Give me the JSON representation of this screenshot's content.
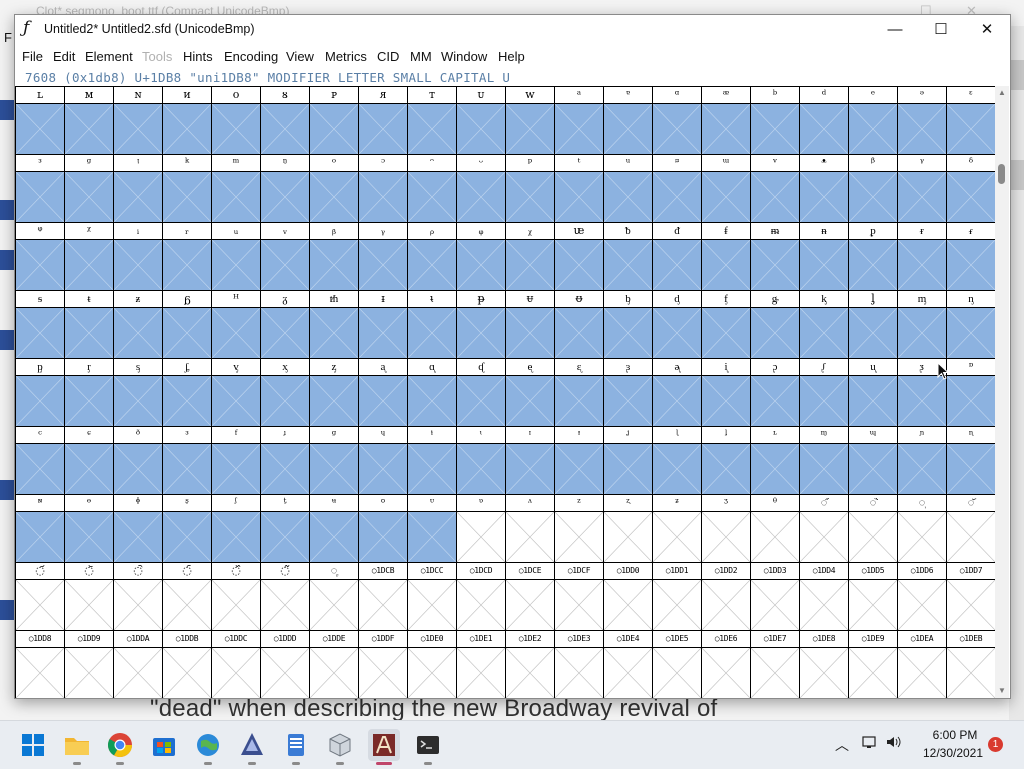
{
  "background_window": {
    "title": "Clot*  segmono_boot.ttf (Compact UnicodeBmp)",
    "menu_letter": "F",
    "caption_text": "\"dead\" when describing the new Broadway revival of"
  },
  "window": {
    "app_icon_glyph": "ƒ",
    "title": "Untitled2*  Untitled2.sfd (UnicodeBmp)",
    "minimize": "—",
    "maximize": "☐",
    "close": "✕"
  },
  "menu": [
    {
      "label": "File",
      "enabled": true
    },
    {
      "label": "Edit",
      "enabled": true
    },
    {
      "label": "Element",
      "enabled": true
    },
    {
      "label": "Tools",
      "enabled": false
    },
    {
      "label": "Hints",
      "enabled": true
    },
    {
      "label": "Encoding",
      "enabled": true
    },
    {
      "label": "View",
      "enabled": true
    },
    {
      "label": "Metrics",
      "enabled": true
    },
    {
      "label": "CID",
      "enabled": true
    },
    {
      "label": "MM",
      "enabled": true
    },
    {
      "label": "Window",
      "enabled": true
    },
    {
      "label": "Help",
      "enabled": true
    }
  ],
  "info_line": "7608 (0x1db8) U+1DB8 \"uni1DB8\" MODIFIER LETTER SMALL CAPITAL U",
  "colors": {
    "filled_cell": "#8cb2e0",
    "info_text": "#5a7fa6"
  },
  "grid": {
    "columns": 20,
    "rows": [
      {
        "labels": [
          "ʟ",
          "ᴍ",
          "ɴ",
          "ᴎ",
          "ᴏ",
          "ᴕ",
          "ᴘ",
          "ᴙ",
          "ᴛ",
          "ᴜ",
          "ᴡ",
          "ᵃ",
          "ᵄ",
          "ᵅ",
          "ᵆ",
          "ᵇ",
          "ᵈ",
          "ᵉ",
          "ᵊ",
          "ᵋ"
        ],
        "filled": 20
      },
      {
        "labels": [
          "ᵌ",
          "ᵍ",
          "ᵎ",
          "ᵏ",
          "ᵐ",
          "ᵑ",
          "ᵒ",
          "ᵓ",
          "ᵔ",
          "ᵕ",
          "ᵖ",
          "ᵗ",
          "ᵘ",
          "ᵙ",
          "ᵚ",
          "ᵛ",
          "ᵜ",
          "ᵝ",
          "ᵞ",
          "ᵟ"
        ],
        "filled": 20
      },
      {
        "labels": [
          "ᵠ",
          "ᵡ",
          "ᵢ",
          "ᵣ",
          "ᵤ",
          "ᵥ",
          "ᵦ",
          "ᵧ",
          "ᵨ",
          "ᵩ",
          "ᵪ",
          "ᵫ",
          "ᵬ",
          "ᵭ",
          "ᵮ",
          "ᵯ",
          "ᵰ",
          "ᵱ",
          "ᵲ",
          "ᵳ"
        ],
        "filled": 20
      },
      {
        "labels": [
          "ᵴ",
          "ᵵ",
          "ᵶ",
          "ᵷ",
          "ᵸ",
          "ᵹ",
          "ᵺ",
          "ᵻ",
          "ᵼ",
          "ᵽ",
          "ᵾ",
          "ᵿ",
          "ᶀ",
          "ᶁ",
          "ᶂ",
          "ᶃ",
          "ᶄ",
          "ᶅ",
          "ᶆ",
          "ᶇ"
        ],
        "filled": 20
      },
      {
        "labels": [
          "ᶈ",
          "ᶉ",
          "ᶊ",
          "ᶋ",
          "ᶌ",
          "ᶍ",
          "ᶎ",
          "ᶏ",
          "ᶐ",
          "ᶑ",
          "ᶒ",
          "ᶓ",
          "ᶔ",
          "ᶕ",
          "ᶖ",
          "ᶗ",
          "ᶘ",
          "ᶙ",
          "ᶚ",
          "ᶛ"
        ],
        "filled": 20
      },
      {
        "labels": [
          "ᶜ",
          "ᶝ",
          "ᶞ",
          "ᶟ",
          "ᶠ",
          "ᶡ",
          "ᶢ",
          "ᶣ",
          "ᶤ",
          "ᶥ",
          "ᶦ",
          "ᶧ",
          "ᶨ",
          "ᶩ",
          "ᶪ",
          "ᶫ",
          "ᶬ",
          "ᶭ",
          "ᶮ",
          "ᶯ"
        ],
        "filled": 20
      },
      {
        "labels": [
          "ᶰ",
          "ᶱ",
          "ᶲ",
          "ᶳ",
          "ᶴ",
          "ᶵ",
          "ᶶ",
          "ᶷ",
          "ᶸ",
          "ᶹ",
          "ᶺ",
          "ᶻ",
          "ᶼ",
          "ᶽ",
          "ᶾ",
          "ᶿ",
          "◌᷀",
          "◌᷁",
          "◌᷂",
          "◌᷃"
        ],
        "filled": 9
      },
      {
        "labels": [
          "◌᷄",
          "◌᷅",
          "◌᷆",
          "◌᷇",
          "◌᷈",
          "◌᷉",
          "◌᷊",
          "○1DCB",
          "○1DCC",
          "○1DCD",
          "○1DCE",
          "○1DCF",
          "○1DD0",
          "○1DD1",
          "○1DD2",
          "○1DD3",
          "○1DD4",
          "○1DD5",
          "○1DD6",
          "○1DD7"
        ],
        "filled": 0
      },
      {
        "labels": [
          "○1DD8",
          "○1DD9",
          "○1DDA",
          "○1DDB",
          "○1DDC",
          "○1DDD",
          "○1DDE",
          "○1DDF",
          "○1DE0",
          "○1DE1",
          "○1DE2",
          "○1DE3",
          "○1DE4",
          "○1DE5",
          "○1DE6",
          "○1DE7",
          "○1DE8",
          "○1DE9",
          "○1DEA",
          "○1DEB"
        ],
        "filled": 0
      }
    ]
  },
  "scrollbar": {
    "up": "▲",
    "down": "▼"
  },
  "taskbar": {
    "icons": [
      "start-icon",
      "file-explorer-icon",
      "chrome-icon",
      "store-icon",
      "browser-icon",
      "inkscape-icon",
      "notepad-icon",
      "app-icon",
      "fontforge-icon",
      "terminal-icon"
    ],
    "time": "6:00 PM",
    "date": "12/30/2021",
    "notifications": "1",
    "tray_chevron": "︿"
  }
}
